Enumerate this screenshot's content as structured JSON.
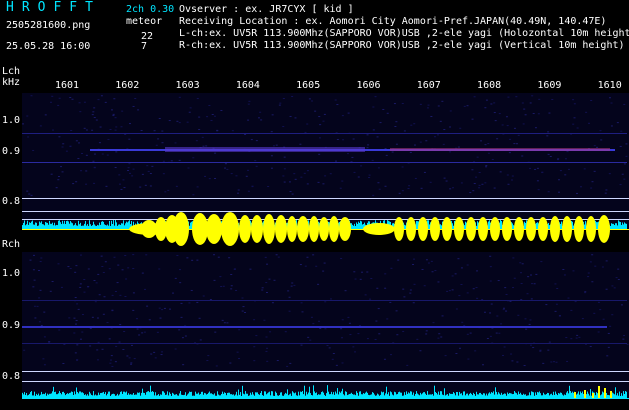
{
  "header": {
    "logo": "HROFFT",
    "mode": "2ch 0.30",
    "kind": "meteor",
    "filename": "2505281600.png",
    "datetime": "25.05.28 16:00",
    "count_l": "22",
    "count_r": "7"
  },
  "info": {
    "observer": "Ovserver                : ex. JR7CYX [ kid ]",
    "location": "Receiving Location : ex. Aomori City Aomori-Pref.JAPAN(40.49N, 140.47E)",
    "lch": "L-ch:ex. UV5R 113.900Mhz(SAPPORO VOR)USB ,2-ele yagi (Holozontal 10m height)",
    "rch": "R-ch:ex. UV5R 113.900Mhz(SAPPORO VOR)USB ,2-ele yagi (Vertical 10m height)"
  },
  "lch_label": "Lch",
  "khz_label": "kHz",
  "rch_label": "Rch",
  "time_ticks": [
    "1601",
    "1602",
    "1603",
    "1604",
    "1605",
    "1606",
    "1607",
    "1608",
    "1609",
    "1610"
  ],
  "freq_labels_l": [
    "1.0",
    "0.9",
    "0.8"
  ],
  "freq_labels_r": [
    "1.0",
    "0.9",
    "0.8"
  ],
  "colors": {
    "text_cyan": "#00e5ff",
    "signal_yellow": "#ffff00",
    "noise_cyan": "#00e5ff",
    "bg": "#000000"
  }
}
